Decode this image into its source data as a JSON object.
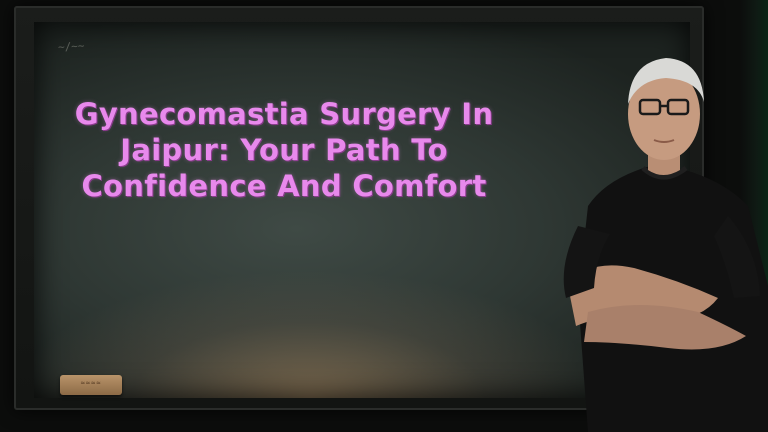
{
  "board": {
    "title": "Gynecomastia Surgery In Jaipur: Your Path To Confidence And Comfort",
    "title_color": "#e889ec"
  },
  "icons": {
    "teacher": "person-arms-crossed-icon"
  }
}
